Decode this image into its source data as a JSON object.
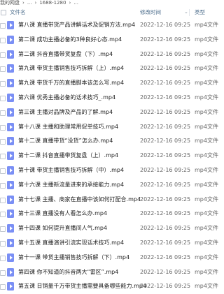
{
  "breadcrumb": [
    "我的网盘",
    "›",
    "...",
    "›",
    "1688-1280",
    "›",
    "..."
  ],
  "header": {
    "name_label": "文件名",
    "date_label": "修改时间",
    "type_label": "类型"
  },
  "files": [
    {
      "name": "第八课 直播带货产品讲解话术及促销方法.mp4",
      "date": "2022-12-16 09:25",
      "type": "mp4文件"
    },
    {
      "name": "第二课 成功主播必备的3种良好心态.mp4",
      "date": "2022-12-16 09:25",
      "type": "mp4文件"
    },
    {
      "name": "第二课 抖音直播带货复盘（下）.mp4",
      "date": "2022-12-16 09:25",
      "type": "mp4文件"
    },
    {
      "name": "第九课 带货主播销售技巧拆解（上）.mp4",
      "date": "2022-12-16 09:25",
      "type": "mp4文件"
    },
    {
      "name": "第九课 带货千万的直播脚本该怎么写.mp4",
      "date": "2022-12-16 09:25",
      "type": "mp4文件"
    },
    {
      "name": "第六课 优秀主播必备的话术技巧_.mp4",
      "date": "2022-12-16 09:25",
      "type": "mp4文件"
    },
    {
      "name": "第三课 主播对品牌及产品的了解.mp4",
      "date": "2022-12-16 09:25",
      "type": "mp4文件"
    },
    {
      "name": "第十八课 主播和助理常用促单技巧.mp4",
      "date": "2022-12-16 09:25",
      "type": "mp4文件"
    },
    {
      "name": "第十二课 直播带货“没货”怎么办.mp4",
      "date": "2022-12-16 09:25",
      "type": "mp4文件"
    },
    {
      "name": "第十二课 抖音直播带货复盘（上）.mp4",
      "date": "2022-12-16 09:25",
      "type": "mp4文件"
    },
    {
      "name": "第十课 带货主播销售技巧拆解（中）.mp4",
      "date": "2022-12-16 09:25",
      "type": "mp4文件"
    },
    {
      "name": "第十六课 主播新流量进来的承接能力.mp4",
      "date": "2022-12-16 09:25",
      "type": "mp4文件"
    },
    {
      "name": "第十七课 主播、商家在直播中该如何打配合.mp4",
      "date": "2022-12-16 09:25",
      "type": "mp4文件"
    },
    {
      "name": "第十三课 直播没有人看怎么办.mp4",
      "date": "2022-12-16 09:25",
      "type": "mp4文件"
    },
    {
      "name": "第十四课 如何提升直播间人气.mp4",
      "date": "2022-12-16 09:25",
      "type": "mp4文件"
    },
    {
      "name": "第十五课 直播演讲引流实现话术技巧.mp4",
      "date": "2022-12-16 09:25",
      "type": "mp4文件"
    },
    {
      "name": "第十一课 带货主播销售技巧拆解（下）.mp4",
      "date": "2022-12-16 09:25",
      "type": "mp4文件"
    },
    {
      "name": "第四课 你不知道的抖音两大“雷区”.mp4",
      "date": "2022-12-16 09:25",
      "type": "mp4文件"
    },
    {
      "name": "第五课 日销量千万带货主播需要具备哪些能力.mp4",
      "date": "2022-12-16 09:25",
      "type": "mp4文件"
    }
  ]
}
